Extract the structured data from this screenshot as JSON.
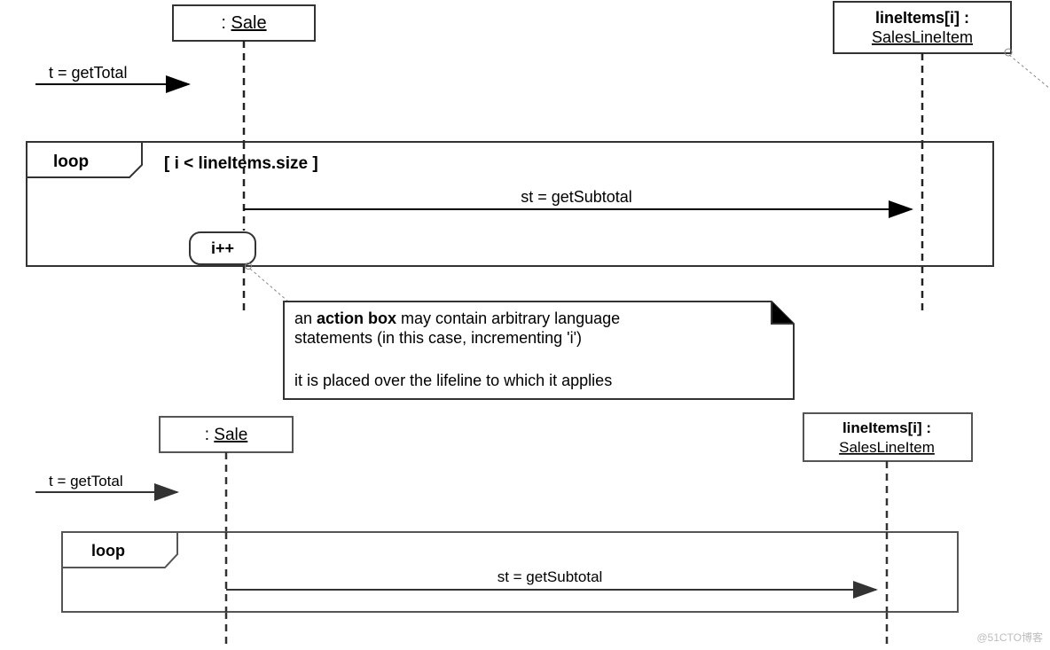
{
  "diagram": {
    "top": {
      "lifelines": {
        "sale": {
          "name_prefix": ": ",
          "name": "Sale"
        },
        "lineitem": {
          "name_line1": "lineItems[i] :",
          "name_line2": "SalesLineItem"
        }
      },
      "messages": {
        "getTotal": "t = getTotal",
        "getSubtotal": "st = getSubtotal"
      },
      "frame": {
        "operator": "loop",
        "guard": "[ i < lineItems.size ]"
      },
      "action_box": {
        "text": "i++"
      },
      "note": {
        "l1a": "an ",
        "l1b": "action box",
        "l1c": " may contain arbitrary language",
        "l2": "statements (in this case, incrementing 'i')",
        "l3": "it is placed over the lifeline to which it applies"
      }
    },
    "bottom": {
      "lifelines": {
        "sale": {
          "name_prefix": ": ",
          "name": "Sale"
        },
        "lineitem": {
          "name_line1": "lineItems[i] :",
          "name_line2": "SalesLineItem"
        }
      },
      "messages": {
        "getTotal": "t = getTotal",
        "getSubtotal": "st = getSubtotal"
      },
      "frame": {
        "operator": "loop"
      }
    }
  },
  "watermark": "@51CTO博客"
}
